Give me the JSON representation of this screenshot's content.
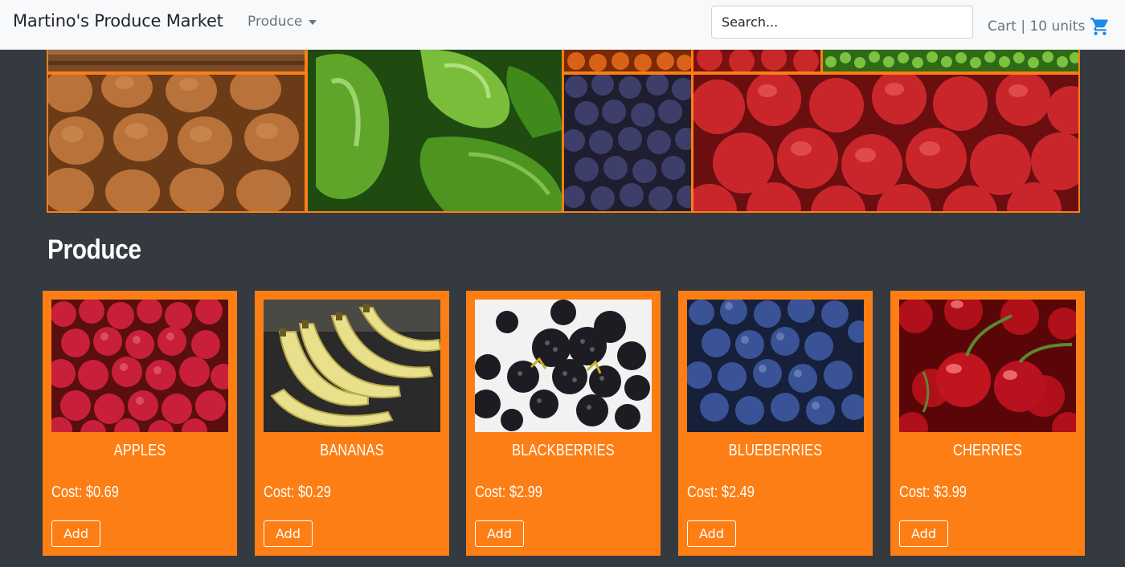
{
  "navbar": {
    "brand": "Martino's Produce Market",
    "dropdown_label": "Produce",
    "search_placeholder": "Search...",
    "cart_label": "Cart | 10 units"
  },
  "colors": {
    "accent": "#fd7e14",
    "page_background": "#343a40",
    "navbar_background": "#f8f9fa"
  },
  "hero": {
    "tiles": [
      "kiwis",
      "green peppers",
      "blueberries",
      "red apples",
      "peas",
      "oranges"
    ]
  },
  "section": {
    "title": "Produce"
  },
  "products": [
    {
      "name": "APPLES",
      "cost": "Cost: $0.69",
      "button": "Add"
    },
    {
      "name": "BANANAS",
      "cost": "Cost: $0.29",
      "button": "Add"
    },
    {
      "name": "BLACKBERRIES",
      "cost": "Cost: $2.99",
      "button": "Add"
    },
    {
      "name": "BLUEBERRIES",
      "cost": "Cost: $2.49",
      "button": "Add"
    },
    {
      "name": "CHERRIES",
      "cost": "Cost: $3.99",
      "button": "Add"
    }
  ]
}
